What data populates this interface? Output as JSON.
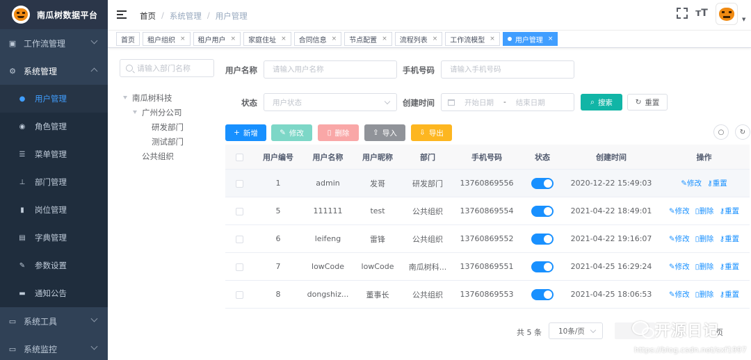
{
  "brand": {
    "title": "南瓜树数据平台"
  },
  "sidebar": {
    "groups_top": [
      {
        "label": "工作流管理",
        "icon": "workflow-icon"
      },
      {
        "label": "系统管理",
        "icon": "gear-icon"
      }
    ],
    "items": [
      {
        "label": "用户管理",
        "icon": "user-icon",
        "active": true
      },
      {
        "label": "角色管理",
        "icon": "role-icon"
      },
      {
        "label": "菜单管理",
        "icon": "menu-tree-icon"
      },
      {
        "label": "部门管理",
        "icon": "org-chart-icon"
      },
      {
        "label": "岗位管理",
        "icon": "post-icon"
      },
      {
        "label": "字典管理",
        "icon": "dictionary-icon"
      },
      {
        "label": "参数设置",
        "icon": "edit-icon"
      },
      {
        "label": "通知公告",
        "icon": "message-icon"
      }
    ],
    "groups_bottom": [
      {
        "label": "系统工具",
        "icon": "toolbox-icon"
      },
      {
        "label": "系统监控",
        "icon": "monitor-icon"
      }
    ]
  },
  "breadcrumb": [
    "首页",
    "系统管理",
    "用户管理"
  ],
  "tags": [
    {
      "label": "首页",
      "closable": false
    },
    {
      "label": "租户组织",
      "closable": true
    },
    {
      "label": "租户用户",
      "closable": true
    },
    {
      "label": "家庭住址",
      "closable": true
    },
    {
      "label": "合同信息",
      "closable": true
    },
    {
      "label": "节点配置",
      "closable": true
    },
    {
      "label": "流程列表",
      "closable": true
    },
    {
      "label": "工作流模型",
      "closable": true
    },
    {
      "label": "用户管理",
      "closable": true,
      "active": true
    }
  ],
  "dept": {
    "search_placeholder": "请输入部门名称",
    "tree": {
      "root": "南瓜树科技",
      "branch": "广州分公司",
      "leaf1": "研发部门",
      "leaf2": "测试部门",
      "other": "公共组织"
    }
  },
  "form": {
    "username_label": "用户名称",
    "username_placeholder": "请输入用户名称",
    "phone_label": "手机号码",
    "phone_placeholder": "请输入手机号码",
    "status_label": "状态",
    "status_placeholder": "用户状态",
    "created_label": "创建时间",
    "start_placeholder": "开始日期",
    "range_sep": "-",
    "end_placeholder": "结束日期",
    "search_btn": "搜索",
    "reset_btn": "重置"
  },
  "toolbar": {
    "add": "新增",
    "edit": "修改",
    "delete": "删除",
    "import": "导入",
    "export": "导出"
  },
  "table": {
    "headers": [
      "用户编号",
      "用户名称",
      "用户昵称",
      "部门",
      "手机号码",
      "状态",
      "创建时间",
      "操作"
    ],
    "rows": [
      {
        "id": "1",
        "username": "admin",
        "nickname": "发哥",
        "dept": "研发部门",
        "phone": "13760869556",
        "created": "2020-12-22 15:49:03"
      },
      {
        "id": "5",
        "username": "111111",
        "nickname": "test",
        "dept": "公共组织",
        "phone": "13760869554",
        "created": "2021-04-22 18:49:01"
      },
      {
        "id": "6",
        "username": "leifeng",
        "nickname": "雷锋",
        "dept": "公共组织",
        "phone": "13760869552",
        "created": "2021-04-22 19:16:07"
      },
      {
        "id": "7",
        "username": "lowCode",
        "nickname": "lowCode",
        "dept": "南瓜树科...",
        "phone": "13760869551",
        "created": "2021-04-25 16:29:24"
      },
      {
        "id": "8",
        "username": "dongshiz...",
        "nickname": "董事长",
        "dept": "公共组织",
        "phone": "13760869553",
        "created": "2021-04-25 18:06:53"
      }
    ],
    "op_edit": "修改",
    "op_delete": "删除",
    "op_reset": "重置"
  },
  "pagination": {
    "total": "共 5 条",
    "page_size": "10条/页",
    "tail": "页"
  },
  "watermark": {
    "brand": "开源日记",
    "url": "https://blog.csdn.net/sxf1997"
  },
  "colors": {
    "sidebar": "#304156",
    "primary": "#1890ff",
    "search": "#11b5a6"
  }
}
